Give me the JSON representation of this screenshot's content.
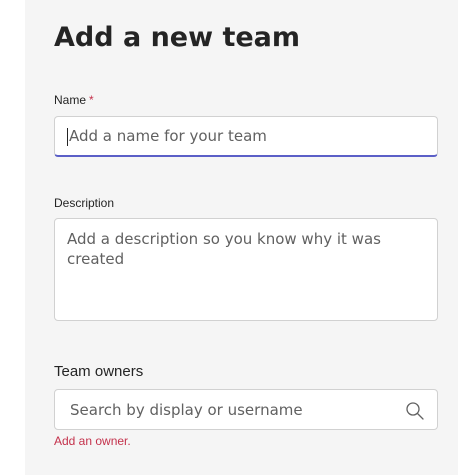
{
  "header": {
    "title": "Add a new team"
  },
  "form": {
    "name": {
      "label": "Name",
      "required_marker": "*",
      "placeholder": "Add a name for your team"
    },
    "description": {
      "label": "Description",
      "placeholder": "Add a description so you know why it was created"
    },
    "owners": {
      "label": "Team owners",
      "placeholder": "Search by display or username",
      "icon": "search-icon",
      "error": "Add an owner."
    }
  },
  "colors": {
    "accent": "#5b5fc7",
    "error": "#c4314b",
    "panel_bg": "#f5f5f5"
  }
}
